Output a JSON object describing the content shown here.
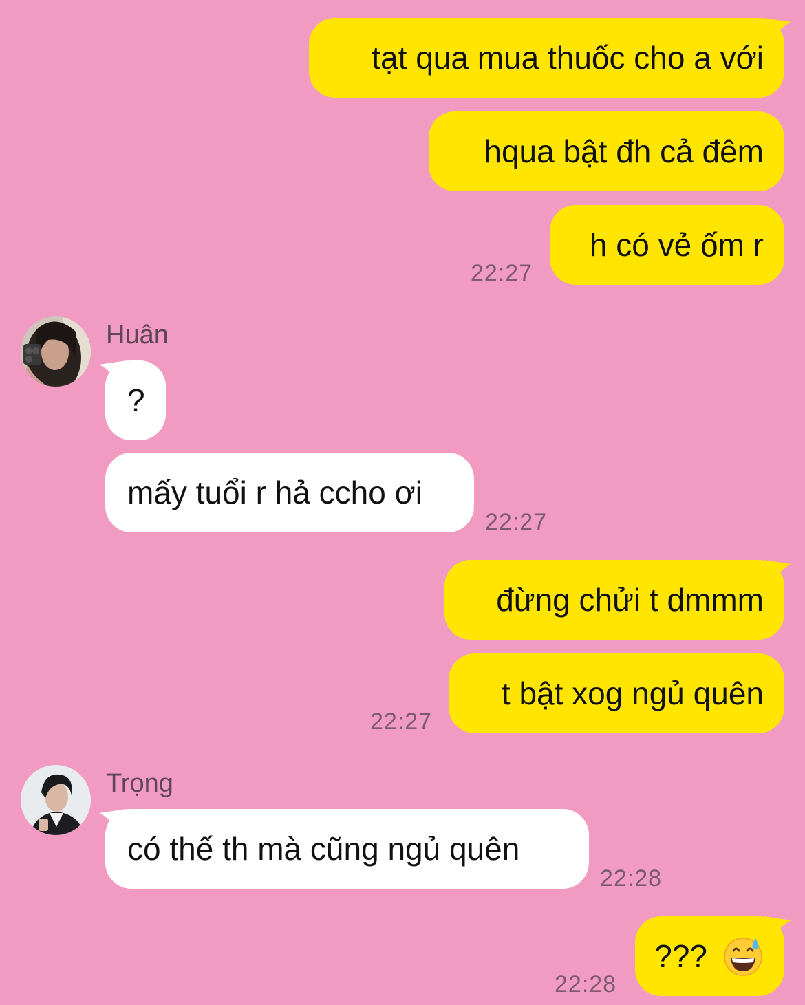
{
  "messages": {
    "m1": "tạt qua mua thuốc cho a với",
    "m2": "hqua bật đh cả đêm",
    "m3": "h có vẻ ốm r",
    "t1": "22:27",
    "sender1": "Huân",
    "m4": "?",
    "m5": "mấy tuổi r hả ccho ơi",
    "t2": "22:27",
    "m6": "đừng chửi t dmmm",
    "m7": "t bật xog ngủ quên",
    "t3": "22:27",
    "sender2": "Trọng",
    "m8": "có thế th mà cũng ngủ quên",
    "t4": "22:28",
    "m9": "???",
    "m9_emoji": "grinning-face-with-sweat-icon",
    "t5": "22:28"
  },
  "colors": {
    "background": "#f29bc2",
    "outgoing_bubble": "#ffe500",
    "incoming_bubble": "#ffffff",
    "timestamp": "#7a5a6c"
  }
}
